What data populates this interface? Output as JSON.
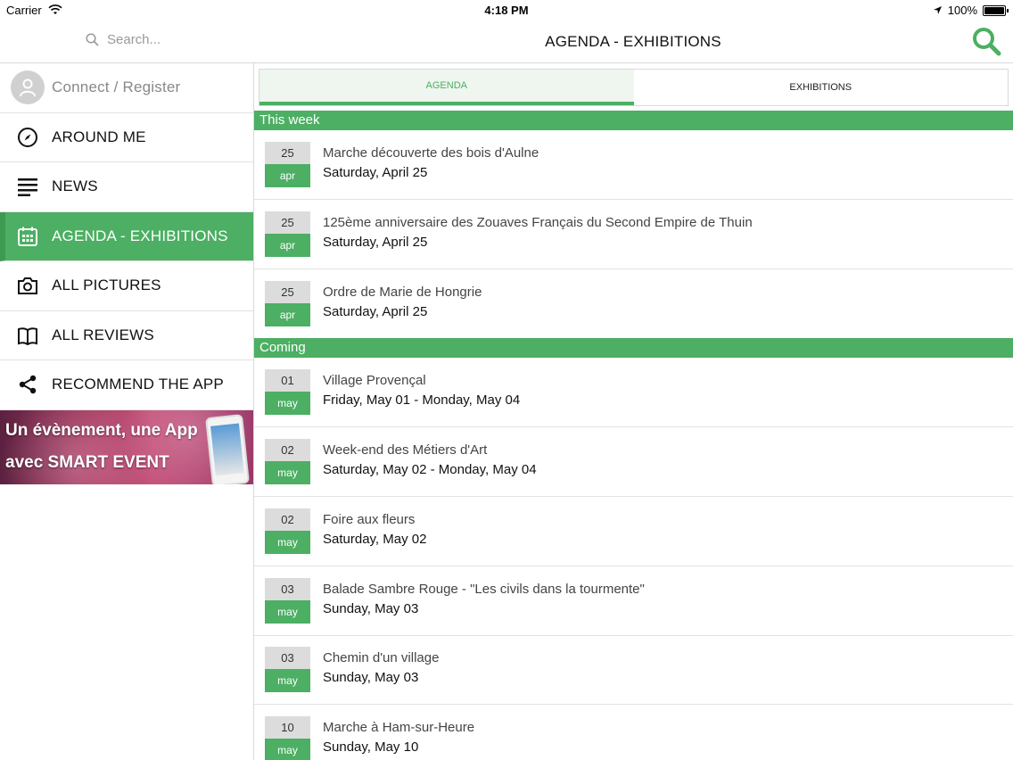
{
  "status_bar": {
    "carrier": "Carrier",
    "time": "4:18 PM",
    "battery": "100%"
  },
  "header": {
    "search_placeholder": "Search...",
    "title": "AGENDA - EXHIBITIONS"
  },
  "sidebar": {
    "connect_label": "Connect / Register",
    "items": [
      {
        "label": "AROUND ME",
        "icon": "compass-icon"
      },
      {
        "label": "NEWS",
        "icon": "lines-icon"
      },
      {
        "label": "AGENDA - EXHIBITIONS",
        "icon": "calendar-icon",
        "active": true
      },
      {
        "label": "ALL PICTURES",
        "icon": "camera-icon"
      },
      {
        "label": "ALL REVIEWS",
        "icon": "book-icon"
      },
      {
        "label": "RECOMMEND THE APP",
        "icon": "share-icon"
      }
    ],
    "banner": {
      "line1": "Un évènement, une App",
      "line2": "avec SMART EVENT"
    }
  },
  "tabs": [
    {
      "label": "AGENDA",
      "active": true
    },
    {
      "label": "EXHIBITIONS",
      "active": false
    }
  ],
  "sections": [
    {
      "title": "This week",
      "events": [
        {
          "day": "25",
          "month": "apr",
          "name": "Marche découverte des bois d'Aulne",
          "date": "Saturday, April 25"
        },
        {
          "day": "25",
          "month": "apr",
          "name": "125ème anniversaire des Zouaves Français du Second Empire de Thuin",
          "date": "Saturday, April 25"
        },
        {
          "day": "25",
          "month": "apr",
          "name": "Ordre de Marie de Hongrie",
          "date": "Saturday, April 25"
        }
      ]
    },
    {
      "title": "Coming",
      "events": [
        {
          "day": "01",
          "month": "may",
          "name": "Village Provençal",
          "date": "Friday, May 01 - Monday, May 04"
        },
        {
          "day": "02",
          "month": "may",
          "name": "Week-end des Métiers d'Art",
          "date": "Saturday, May 02 - Monday, May 04"
        },
        {
          "day": "02",
          "month": "may",
          "name": "Foire aux fleurs",
          "date": "Saturday, May 02"
        },
        {
          "day": "03",
          "month": "may",
          "name": "Balade Sambre Rouge - \"Les civils dans la tourmente\"",
          "date": "Sunday, May 03"
        },
        {
          "day": "03",
          "month": "may",
          "name": "Chemin d'un village",
          "date": "Sunday, May 03"
        },
        {
          "day": "10",
          "month": "may",
          "name": "Marche à Ham-sur-Heure",
          "date": "Sunday, May 10"
        }
      ]
    }
  ],
  "colors": {
    "accent": "#4caf63",
    "badge_grey": "#dcdcdc"
  }
}
